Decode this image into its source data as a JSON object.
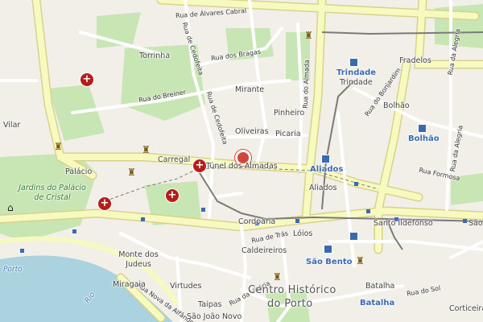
{
  "map": {
    "colors": {
      "land": "#f2efe9",
      "park": "#c8e6b4",
      "water": "#aad3df",
      "major_road": "#f7fabf",
      "road": "#ffffff",
      "rail": "#8a8a8a",
      "metro_blue": "#3a6ab0",
      "hospital": "#b71c1c",
      "pin": "#d1453b"
    },
    "streets": {
      "alvares_cabral": "Rua de Álvares Cabral",
      "cedofeita1": "Rua de Cedofeita",
      "cedofeita2": "Rua de Cedofeita",
      "bragas": "Rua dos Bragas",
      "breiner": "Rua do Breiner",
      "almada": "Rua do Almada",
      "bonjardim": "Rua do Bonjardim",
      "alegria1": "Rua da Alegria",
      "alegria2": "Rua da Alegria",
      "formosa": "Rua Formosa",
      "tras": "Rua de Trás",
      "vitoria": "Rua da Vitória",
      "sol": "Rua do Sol",
      "nova_alfandega": "Rua Nova da Alfândega"
    },
    "places": {
      "torrinha": "Torrinha",
      "mirante": "Mirante",
      "pinheiro": "Pinheiro",
      "oliveiras": "Oliveiras",
      "picaria": "Picaria",
      "carregal": "Carregal",
      "tunel": "Túnel dos Almadas",
      "vilar": "Vilar",
      "palacio": "Palácio",
      "jardins": "Jardins do Palácio de Cristal",
      "aliados_area": "Aliados",
      "cordoaria": "Cordoaria",
      "loios": "Lóios",
      "caldeireiros": "Caldeireiros",
      "monte_judeus": "Monte dos Judeus",
      "miragaia": "Miragaia",
      "virtudes": "Virtudes",
      "taipas": "Taipas",
      "sao_joao_novo": "São João Novo",
      "batalha_area": "Batalha",
      "corticeira": "Corticeira",
      "fradelos": "Fradelos",
      "trindade_area": "Trindade",
      "bolhao_area": "Bolhão",
      "santo_ildefonso": "Santo Ildefonso",
      "sao": "São",
      "porto": "Porto",
      "rio": "Rio",
      "centro1": "Centro Histórico",
      "centro2": "do Porto"
    },
    "metro": {
      "trindade": "Trindade",
      "bolhao": "Bolhão",
      "aliados": "Aliados",
      "sao_bento": "São Bento",
      "batalha": "Batalha"
    }
  }
}
